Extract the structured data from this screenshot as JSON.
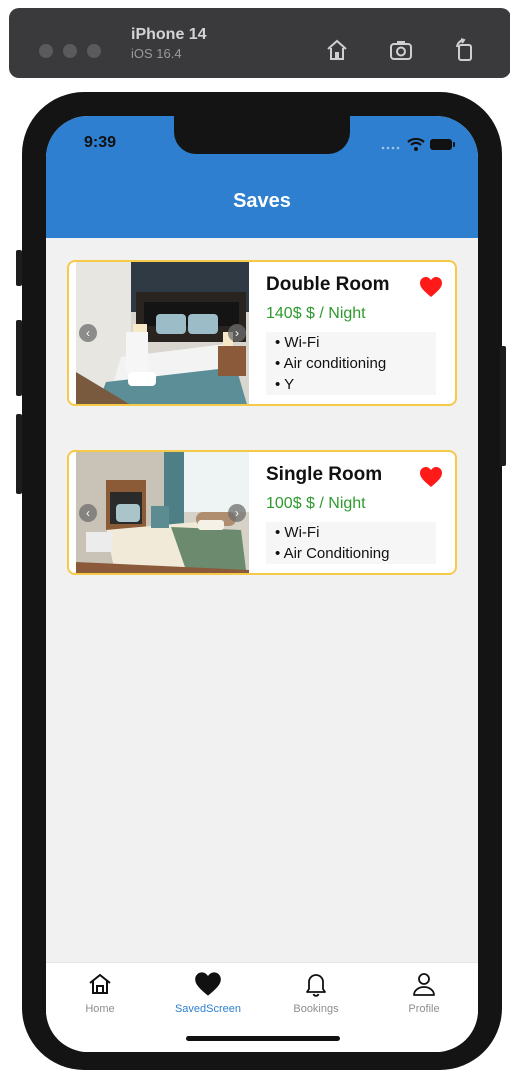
{
  "simulator": {
    "device": "iPhone 14",
    "os": "iOS 16.4",
    "icons": [
      "home-icon",
      "screenshot-icon",
      "rotate-icon"
    ]
  },
  "status_bar": {
    "time": "9:39",
    "icons": [
      "signal-dots-icon",
      "wifi-icon",
      "battery-icon"
    ]
  },
  "header": {
    "title": "Saves",
    "color": "#2e7fd0"
  },
  "cards": [
    {
      "title": "Double Room",
      "price": "140$ $ / Night",
      "amenities": [
        "Wi-Fi",
        "Air conditioning",
        "Y"
      ],
      "favorite": true
    },
    {
      "title": "Single Room",
      "price": "100$ $ / Night",
      "amenities": [
        "Wi-Fi",
        "Air Conditioning"
      ],
      "favorite": true
    }
  ],
  "tabbar": {
    "tabs": [
      {
        "label": "Home",
        "icon": "home-icon",
        "active": false
      },
      {
        "label": "SavedScreen",
        "icon": "heart-icon",
        "active": true
      },
      {
        "label": "Bookings",
        "icon": "bell-icon",
        "active": false
      },
      {
        "label": "Profile",
        "icon": "person-icon",
        "active": false
      }
    ]
  },
  "colors": {
    "accent": "#2e7fd0",
    "price_green": "#2e9b2e",
    "favorite_red": "#ff1a1a",
    "card_border": "#f7c948"
  }
}
